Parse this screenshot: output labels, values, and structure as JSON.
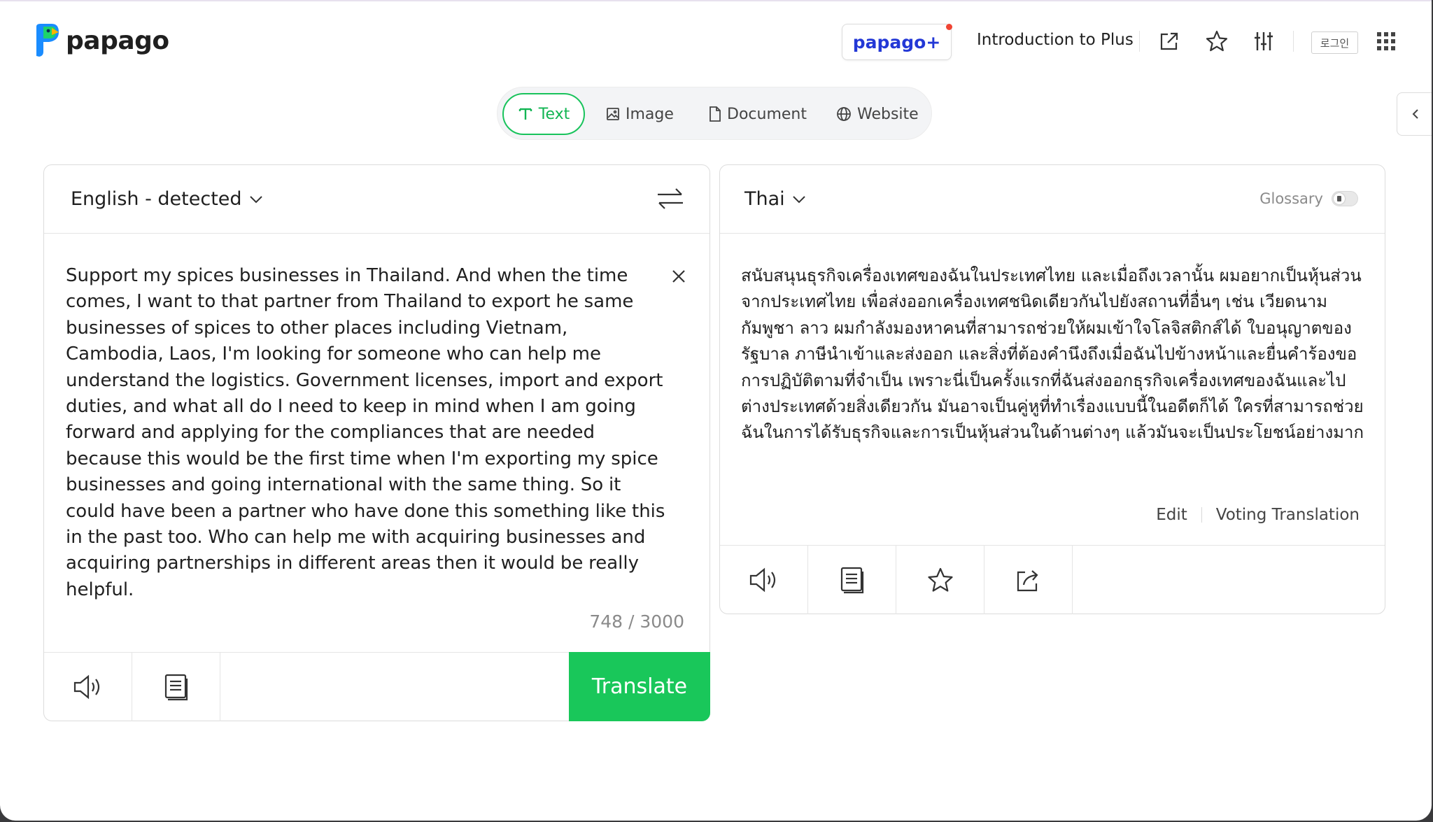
{
  "header": {
    "logo_text": "papago",
    "plus_label": "papago+",
    "intro_label": "Introduction to Plus",
    "login_label": "로그인"
  },
  "tabs": [
    {
      "label": "Text",
      "active": true
    },
    {
      "label": "Image",
      "active": false
    },
    {
      "label": "Document",
      "active": false
    },
    {
      "label": "Website",
      "active": false
    }
  ],
  "source": {
    "language": "English - detected",
    "text": "Support my spices businesses in Thailand. And when the time comes, I want to that partner from Thailand to export he same businesses of spices to other places including Vietnam, Cambodia, Laos, I'm looking for someone who can help me understand the logistics. Government licenses, import and export duties, and what all do I need to keep in mind when I am going forward and applying for the compliances that are needed because this would be the first time when I'm exporting my spice businesses and going international with the same thing. So it could have been a partner who have done this something like this in the past too. Who can help me with acquiring businesses and acquiring partnerships in different areas then it would be really helpful.",
    "char_count": "748 / 3000",
    "translate_label": "Translate"
  },
  "target": {
    "language": "Thai",
    "glossary_label": "Glossary",
    "text": "สนับสนุนธุรกิจเครื่องเทศของฉันในประเทศไทย และเมื่อถึงเวลานั้น ผมอยากเป็นหุ้นส่วนจากประเทศไทย เพื่อส่งออกเครื่องเทศชนิดเดียวกันไปยังสถานที่อื่นๆ เช่น เวียดนาม กัมพูชา ลาว ผมกำลังมองหาคนที่สามารถช่วยให้ผมเข้าใจโลจิสติกส์ได้ ใบอนุญาตของรัฐบาล ภาษีนำเข้าและส่งออก และสิ่งที่ต้องคำนึงถึงเมื่อฉันไปข้างหน้าและยื่นคำร้องขอการปฏิบัติตามที่จำเป็น เพราะนี่เป็นครั้งแรกที่ฉันส่งออกธุรกิจเครื่องเทศของฉันและไปต่างประเทศด้วยสิ่งเดียวกัน มันอาจเป็นคู่หูที่ทำเรื่องแบบนี้ในอดีตก็ได้ ใครที่สามารถช่วยฉันในการได้รับธุรกิจและการเป็นหุ้นส่วนในด้านต่างๆ แล้วมันจะเป็นประโยชน์อย่างมาก",
    "edit_label": "Edit",
    "voting_label": "Voting Translation"
  },
  "colors": {
    "brand_green": "#19c75a",
    "plus_blue": "#2338d6",
    "logo_blue": "#1a8cff",
    "logo_green": "#1dd36b"
  },
  "icons": [
    "external-link-icon",
    "star-icon",
    "sliders-icon",
    "grid-menu-icon",
    "swap-icon",
    "close-icon",
    "speaker-icon",
    "copy-icon",
    "share-icon",
    "chevron-left-icon",
    "chevron-down-icon"
  ]
}
